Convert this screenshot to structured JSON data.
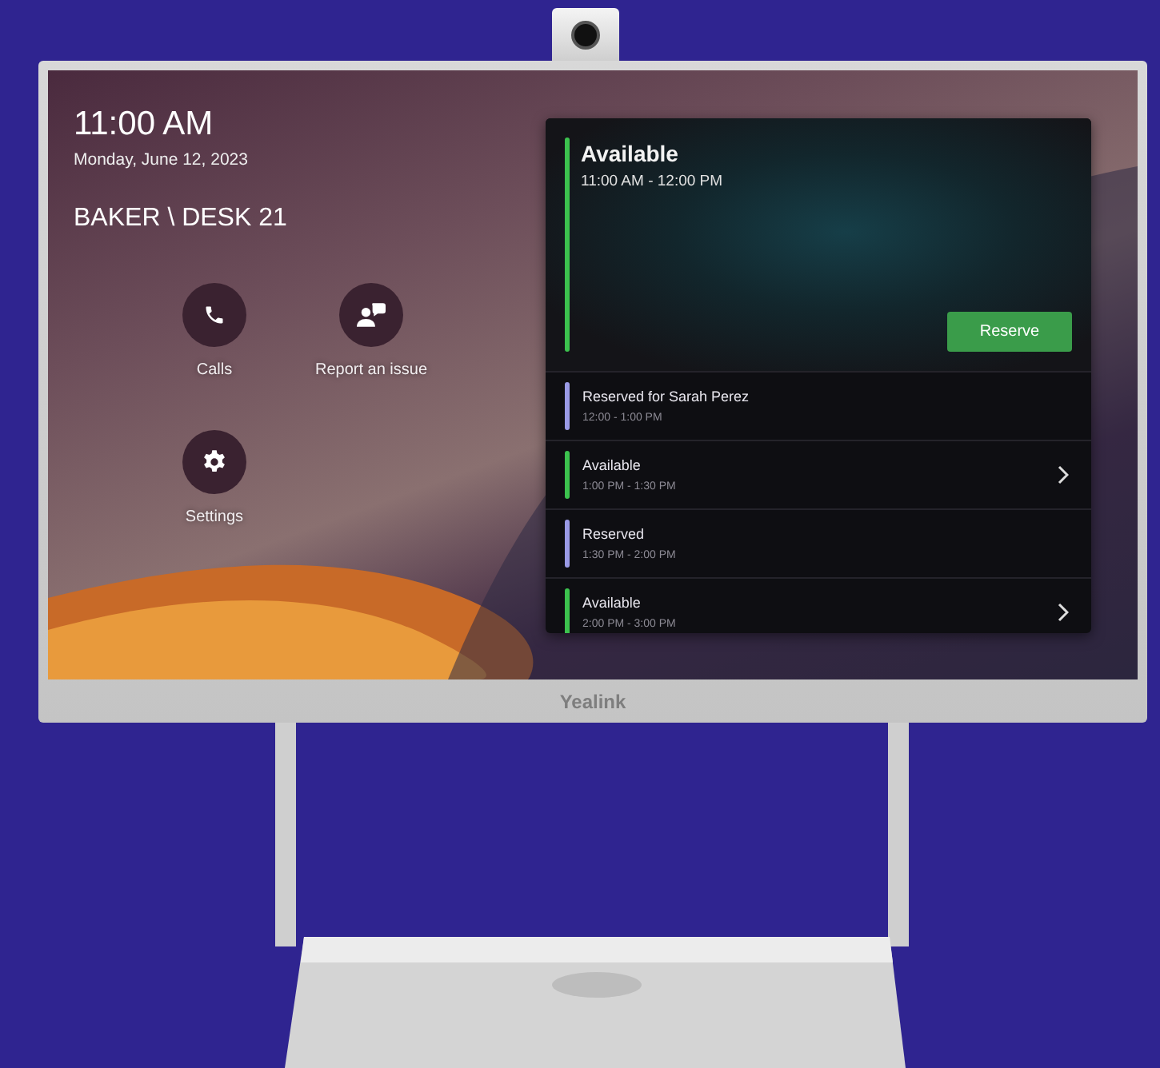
{
  "screen": {
    "time": "11:00 AM",
    "date": "Monday, June 12, 2023",
    "room": "BAKER \\ DESK 21",
    "apps": [
      {
        "label": "Calls",
        "kind": "phone"
      },
      {
        "label": "Report an issue",
        "kind": "people"
      },
      {
        "label": "Settings",
        "kind": "gear"
      }
    ],
    "current": {
      "status": "Available",
      "time": "11:00 AM - 12:00 PM",
      "color": "#3cc24e",
      "button": "Reserve"
    },
    "schedule": [
      {
        "status": "Reserved for Sarah Perez",
        "time": "12:00 - 1:00 PM",
        "color": "#9a9ae6",
        "bookable": false
      },
      {
        "status": "Available",
        "time": "1:00 PM - 1:30 PM",
        "color": "#3cc24e",
        "bookable": true
      },
      {
        "status": "Reserved",
        "time": "1:30 PM - 2:00 PM",
        "color": "#9a9ae6",
        "bookable": false
      },
      {
        "status": "Available",
        "time": "2:00 PM - 3:00 PM",
        "color": "#3cc24e",
        "bookable": true
      }
    ]
  },
  "device": {
    "brand": "Yealink"
  }
}
